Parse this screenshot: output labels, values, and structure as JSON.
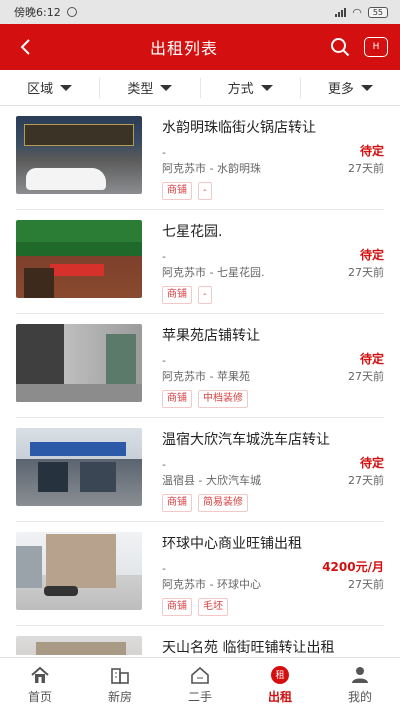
{
  "status_bar": {
    "time": "傍晚6:12",
    "battery": "55"
  },
  "header": {
    "title": "出租列表",
    "home_badge": "H"
  },
  "filters": [
    {
      "label": "区域"
    },
    {
      "label": "类型"
    },
    {
      "label": "方式"
    },
    {
      "label": "更多"
    }
  ],
  "listings": [
    {
      "title": "水韵明珠临街火锅店转让",
      "subtitle": "-",
      "price": "待定",
      "location": "阿克苏市 - 水韵明珠",
      "age": "27天前",
      "tags": [
        "商铺",
        "-"
      ]
    },
    {
      "title": "七星花园.",
      "subtitle": "-",
      "price": "待定",
      "location": "阿克苏市 - 七星花园.",
      "age": "27天前",
      "tags": [
        "商铺",
        "-"
      ]
    },
    {
      "title": "苹果苑店铺转让",
      "subtitle": "-",
      "price": "待定",
      "location": "阿克苏市 - 苹果苑",
      "age": "27天前",
      "tags": [
        "商铺",
        "中档装修"
      ]
    },
    {
      "title": "温宿大欣汽车城洗车店转让",
      "subtitle": "-",
      "price": "待定",
      "location": "温宿县 - 大欣汽车城",
      "age": "27天前",
      "tags": [
        "商铺",
        "简易装修"
      ]
    },
    {
      "title": "环球中心商业旺铺出租",
      "subtitle": "-",
      "price": "4200元/月",
      "location": "阿克苏市 - 环球中心",
      "age": "27天前",
      "tags": [
        "商铺",
        "毛坯"
      ]
    },
    {
      "title": "天山名苑 临街旺铺转让出租",
      "subtitle": "",
      "price": "",
      "location": "",
      "age": "",
      "tags": []
    }
  ],
  "tabs": [
    {
      "label": "首页",
      "icon": "home-icon"
    },
    {
      "label": "新房",
      "icon": "building-icon"
    },
    {
      "label": "二手",
      "icon": "house-icon"
    },
    {
      "label": "出租",
      "icon": "rent-icon",
      "icon_text": "租"
    },
    {
      "label": "我的",
      "icon": "user-icon"
    }
  ],
  "colors": {
    "brand": "#d40f0f",
    "price": "#d40f0f",
    "tag_text": "#d84040"
  }
}
